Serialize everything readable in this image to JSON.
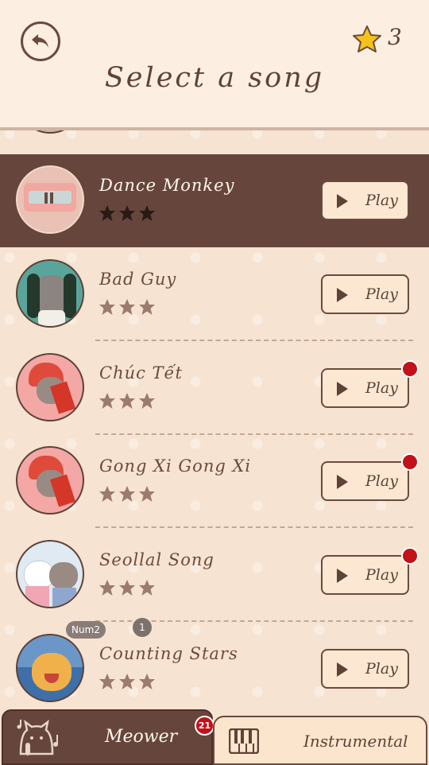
{
  "header": {
    "title": "Select a song",
    "star_count": "3"
  },
  "songs": [
    {
      "title": "Dance Monkey",
      "play_label": "Play",
      "stars_earned": 3,
      "active": true,
      "has_notification": false
    },
    {
      "title": "Bad Guy",
      "play_label": "Play",
      "stars_earned": 0,
      "active": false,
      "has_notification": false
    },
    {
      "title": "Chúc Tết",
      "play_label": "Play",
      "stars_earned": 0,
      "active": false,
      "has_notification": true
    },
    {
      "title": "Gong Xi Gong Xi",
      "play_label": "Play",
      "stars_earned": 0,
      "active": false,
      "has_notification": true
    },
    {
      "title": "Seollal Song",
      "play_label": "Play",
      "stars_earned": 0,
      "active": false,
      "has_notification": true
    },
    {
      "title": "Counting Stars",
      "play_label": "Play",
      "stars_earned": 0,
      "active": false,
      "has_notification": false
    }
  ],
  "overlay": {
    "num2_label": "Num2",
    "one_label": "1"
  },
  "tabs": {
    "meower_label": "Meower",
    "meower_badge": "21",
    "instrumental_label": "Instrumental"
  },
  "colors": {
    "background": "#f6e3d2",
    "header_bg": "#fcefe2",
    "active_row": "#66463c",
    "accent_brown": "#5e4238",
    "notification": "#c3111a",
    "star_gold": "#f5c21b"
  }
}
